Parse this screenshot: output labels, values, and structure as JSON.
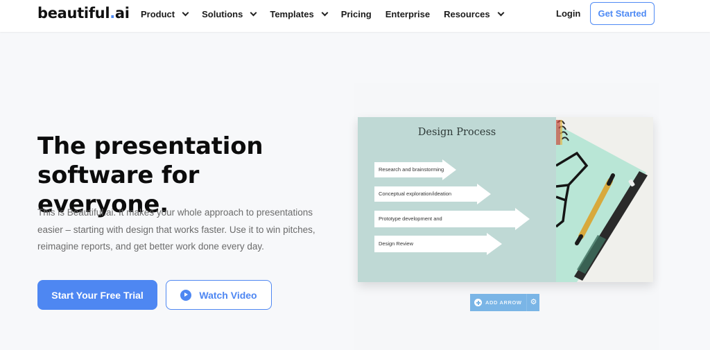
{
  "header": {
    "logo": {
      "text_main": "beautiful",
      "text_dot": ".",
      "text_suffix": "ai"
    },
    "nav": [
      {
        "label": "Product",
        "has_dropdown": true
      },
      {
        "label": "Solutions",
        "has_dropdown": true
      },
      {
        "label": "Templates",
        "has_dropdown": true
      },
      {
        "label": "Pricing",
        "has_dropdown": false
      },
      {
        "label": "Enterprise",
        "has_dropdown": false
      },
      {
        "label": "Resources",
        "has_dropdown": true
      }
    ],
    "login_label": "Login",
    "get_started_label": "Get Started"
  },
  "hero": {
    "title_line1": "The presentation",
    "title_line2": "software for everyone.",
    "description": "This is Beautiful.ai. It makes your whole approach to presentations easier – starting with design that works faster. Use it to win pitches, reimagine reports, and get better work done every day.",
    "primary_cta": "Start Your Free Trial",
    "secondary_cta": "Watch Video"
  },
  "demo": {
    "slide_title": "Design Process",
    "arrows": [
      {
        "label": "Research and brainstorming"
      },
      {
        "label": "Conceptual exploration/ideation"
      },
      {
        "label": "Prototype development and"
      },
      {
        "label": "Design Review"
      }
    ],
    "add_arrow_label": "ADD ARROW",
    "photo_description": "notebook with glasses and pen"
  },
  "colors": {
    "brand_blue": "#4e87f2",
    "slide_teal": "#bfd9d5",
    "toolbar_blue": "#7ab5e6",
    "page_background": "#f7f8fa"
  }
}
